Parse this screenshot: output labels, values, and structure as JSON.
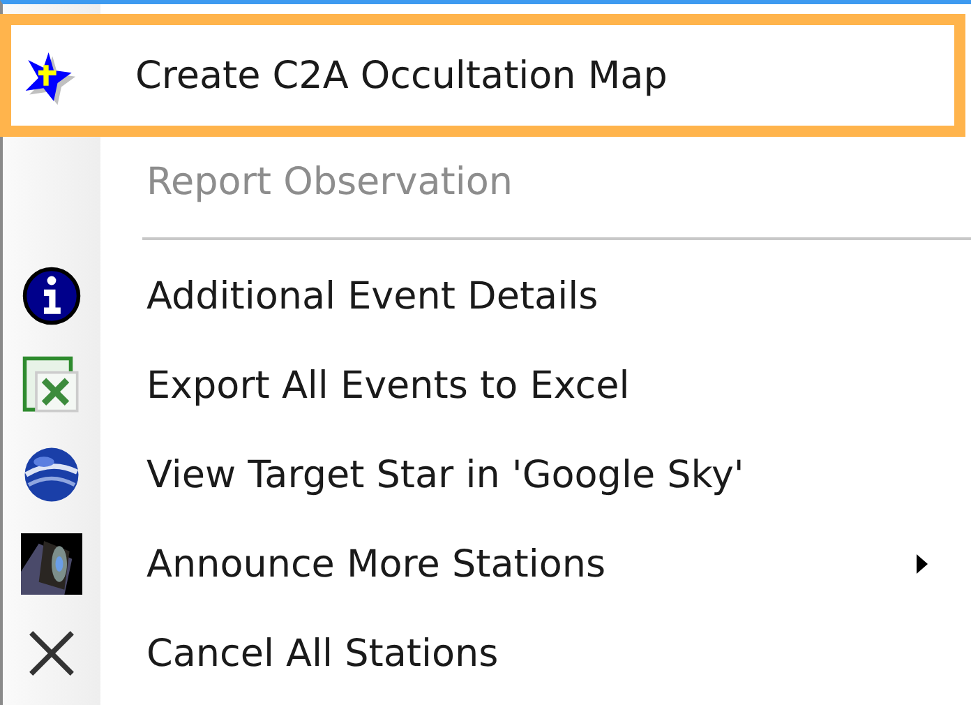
{
  "menu": {
    "items": [
      {
        "kind": "item",
        "label": "Create C2A Occultation Map",
        "selected": true,
        "disabled": false,
        "has_submenu": false
      },
      {
        "kind": "item",
        "label": "Report Observation",
        "selected": false,
        "disabled": true,
        "has_submenu": false
      },
      {
        "kind": "separator"
      },
      {
        "kind": "item",
        "label": "Additional Event Details",
        "selected": false,
        "disabled": false,
        "has_submenu": false
      },
      {
        "kind": "item",
        "label": "Export All Events to Excel",
        "selected": false,
        "disabled": false,
        "has_submenu": false
      },
      {
        "kind": "item",
        "label": "View Target Star in 'Google Sky'",
        "selected": false,
        "disabled": false,
        "has_submenu": false
      },
      {
        "kind": "item",
        "label": "Announce More Stations",
        "selected": false,
        "disabled": false,
        "has_submenu": true
      },
      {
        "kind": "item",
        "label": "Cancel All Stations",
        "selected": false,
        "disabled": false,
        "has_submenu": false
      }
    ]
  }
}
